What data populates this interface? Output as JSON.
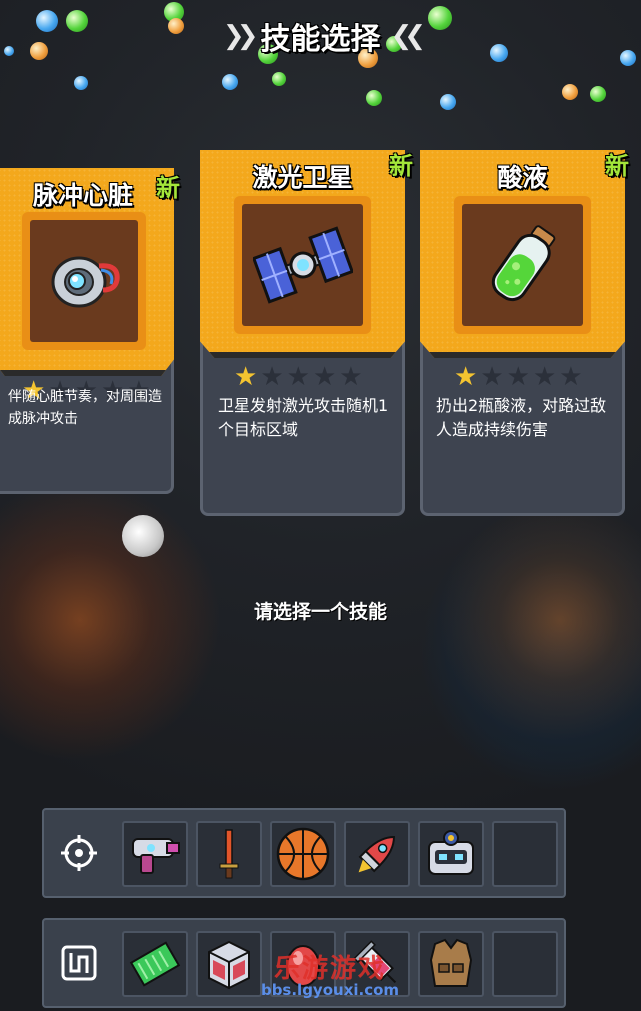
{
  "title": "技能选择",
  "prompt": "请选择一个技能",
  "badge_new": "新",
  "cards": [
    {
      "name": "脉冲心脏",
      "icon": "pulse-heart-icon",
      "stars_filled": 1,
      "stars_total": 5,
      "desc": "伴随心脏节奏，对周围造成脉冲攻击",
      "is_new": true
    },
    {
      "name": "激光卫星",
      "icon": "laser-satellite-icon",
      "stars_filled": 1,
      "stars_total": 5,
      "desc": "卫星发射激光攻击随机1个目标区域",
      "is_new": true
    },
    {
      "name": "酸液",
      "icon": "acid-flask-icon",
      "stars_filled": 1,
      "stars_total": 5,
      "desc": "扔出2瓶酸液，对路过敌人造成持续伤害",
      "is_new": true
    }
  ],
  "weapon_bar": {
    "lead_icon": "crosshair-icon",
    "slots": [
      "raygun-icon",
      "flame-sword-icon",
      "basketball-icon",
      "rocket-icon",
      "robot-helmet-icon",
      "empty-slot"
    ]
  },
  "passive_bar": {
    "lead_icon": "circuit-icon",
    "slots": [
      "circuit-board-icon",
      "supply-crate-icon",
      "red-egg-icon",
      "syringe-icon",
      "armor-vest-icon",
      "empty-slot"
    ]
  },
  "watermark": {
    "line1": "乐游游戏",
    "line2": "bbs.lgyouxi.com"
  },
  "colors": {
    "card_orange": "#f3a81c",
    "new_green": "#a4e63a",
    "star_gold": "#f4c430",
    "panel": "#3e4450"
  }
}
